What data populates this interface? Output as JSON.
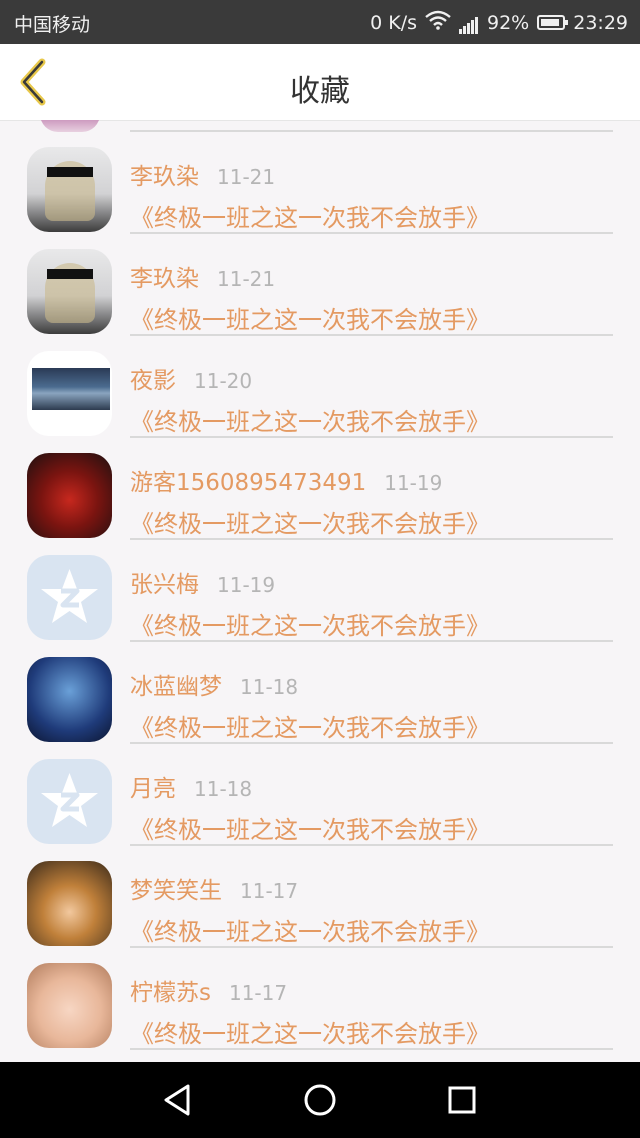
{
  "status_bar": {
    "carrier": "中国移动",
    "network_speed": "0 K/s",
    "battery": "92%",
    "battery_level": 0.92,
    "time": "23:29",
    "icons": [
      "wifi-icon",
      "signal-icon",
      "battery-icon"
    ]
  },
  "header": {
    "title": "收藏",
    "back_icon": "chevron-left-icon",
    "accent_color": "#e8c84a"
  },
  "favorites": [
    {
      "user": "李玖染",
      "date": "11-21",
      "book": "《终极一班之这一次我不会放手》",
      "avatar": "blindfold-girl"
    },
    {
      "user": "李玖染",
      "date": "11-21",
      "book": "《终极一班之这一次我不会放手》",
      "avatar": "blindfold-girl"
    },
    {
      "user": "夜影",
      "date": "11-20",
      "book": "《终极一班之这一次我不会放手》",
      "avatar": "landscape"
    },
    {
      "user": "游客1560895473491",
      "date": "11-19",
      "book": "《终极一班之这一次我不会放手》",
      "avatar": "red-dress"
    },
    {
      "user": "张兴梅",
      "date": "11-19",
      "book": "《终极一班之这一次我不会放手》",
      "avatar": "default-star"
    },
    {
      "user": "冰蓝幽梦",
      "date": "11-18",
      "book": "《终极一班之这一次我不会放手》",
      "avatar": "anime"
    },
    {
      "user": "月亮",
      "date": "11-18",
      "book": "《终极一班之这一次我不会放手》",
      "avatar": "default-star"
    },
    {
      "user": "梦笑笑生",
      "date": "11-17",
      "book": "《终极一班之这一次我不会放手》",
      "avatar": "luffy"
    },
    {
      "user": "柠檬苏s",
      "date": "11-17",
      "book": "《终极一班之这一次我不会放手》",
      "avatar": "child"
    }
  ],
  "colors": {
    "name": "#e49a62",
    "date": "#b5b5b5",
    "divider": "#d9d9d9",
    "background": "#f7f5f7"
  },
  "system_nav": {
    "icons": [
      "back-triangle-icon",
      "home-circle-icon",
      "recents-square-icon"
    ]
  }
}
